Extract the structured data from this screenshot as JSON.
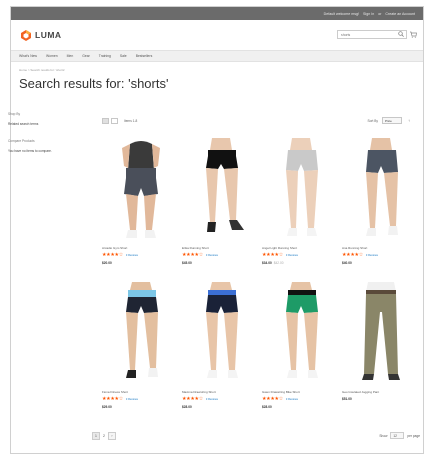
{
  "topbar": {
    "links": [
      "Default welcome msg!",
      "Sign In",
      "or",
      "Create an Account"
    ]
  },
  "header": {
    "logo_text": "LUMA",
    "search_placeholder": "shorts"
  },
  "nav": {
    "items": [
      "What's New",
      "Women",
      "Men",
      "Gear",
      "Training",
      "Sale",
      "Bestsellers"
    ]
  },
  "breadcrumb": "Home  >  Search results for: 'shorts'",
  "page_title": "Search results for: 'shorts'",
  "sidebar": {
    "heading1": "Shop By",
    "text1": "Related search terms",
    "heading2": "Compare Products",
    "text2": "You have no items to compare."
  },
  "toolbar": {
    "items_count": "Items 1-8",
    "sort_label": "Sort By",
    "sort_value": "Price"
  },
  "products": [
    {
      "name": "Arcadio Gym Short",
      "stars": "★★★★☆",
      "reviews": "3 Reviews",
      "price": "$20.00",
      "old_price": ""
    },
    {
      "name": "Erika Running Short",
      "stars": "★★★★☆",
      "reviews": "3 Reviews",
      "price": "$45.00",
      "old_price": ""
    },
    {
      "name": "Angel Light Running Short",
      "stars": "★★★★☆",
      "reviews": "3 Reviews",
      "price": "$34.00",
      "old_price": "$42.00"
    },
    {
      "name": "Ana Running Short",
      "stars": "★★★★☆",
      "reviews": "3 Reviews",
      "price": "$40.00",
      "old_price": ""
    },
    {
      "name": "Fiona Fitness Short",
      "stars": "★★★★☆",
      "reviews": "3 Reviews",
      "price": "$29.00",
      "old_price": ""
    },
    {
      "name": "Maxima Drawstring Short",
      "stars": "★★★★☆",
      "reviews": "3 Reviews",
      "price": "$28.00",
      "old_price": ""
    },
    {
      "name": "Gwen Drawstring Bike Short",
      "stars": "★★★★☆",
      "reviews": "3 Reviews",
      "price": "$28.00",
      "old_price": ""
    },
    {
      "name": "Geo Insulated Jogging Pant",
      "stars": "",
      "reviews": "",
      "price": "$51.00",
      "old_price": ""
    }
  ],
  "pager": {
    "page1": "1",
    "page2": "2",
    "next": "›"
  },
  "limiter": {
    "show_label": "Show",
    "value": "12",
    "per_page": "per page"
  },
  "colors": {
    "accent": "#1979c3",
    "star": "#ff5501",
    "topbar": "#6b6b6b"
  }
}
